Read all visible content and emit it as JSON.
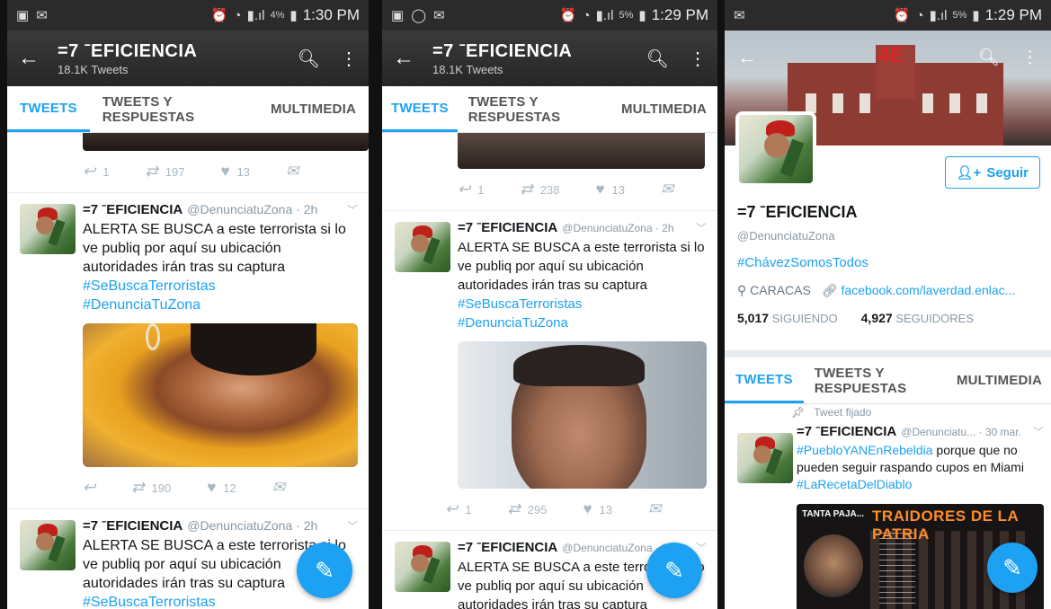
{
  "status_bars": [
    {
      "time": "1:30 PM",
      "battery": "4%",
      "icons": [
        "image-icon",
        "mail-icon"
      ]
    },
    {
      "time": "1:29 PM",
      "battery": "5%",
      "icons": [
        "image-icon",
        "whatsapp-icon",
        "mail-icon"
      ]
    },
    {
      "time": "1:29 PM",
      "battery": "5%",
      "icons": [
        "mail-icon"
      ]
    }
  ],
  "account": {
    "name": "=7 ˉEFICIENCIA",
    "tweet_count": "18.1K Tweets",
    "handle": "@DenunciatuZona",
    "handle_short": "@Denunciatu...",
    "bio_hashtag": "#ChávezSomosTodos",
    "location": "CARACAS",
    "website": "facebook.com/laverdad.enlac...",
    "following_count": "5,017",
    "following_label": "SIGUIENDO",
    "followers_count": "4,927",
    "followers_label": "SEGUIDORES",
    "follow_label": "Seguir"
  },
  "tabs": [
    "TWEETS",
    "TWEETS Y RESPUESTAS",
    "MULTIMEDIA"
  ],
  "feed_tweet": {
    "time": "2h",
    "text": "ALERTA SE BUSCA a este terrorista si lo ve publiq por aquí su ubicación autoridades irán tras su captura",
    "hashtags": [
      "#SeBuscaTerroristas",
      "#DenunciaTuZona"
    ]
  },
  "panel1": {
    "top_actions": {
      "reply": "1",
      "retweets": "197",
      "likes": "13"
    },
    "tweet_actions": {
      "retweets": "190",
      "likes": "12"
    }
  },
  "panel2": {
    "top_actions": {
      "reply": "1",
      "retweets": "238",
      "likes": "13"
    },
    "tweet_actions": {
      "reply": "1",
      "retweets": "295",
      "likes": "13"
    }
  },
  "pinned_tweet": {
    "label": "Tweet fijado",
    "time": "30 mar.",
    "hashtag1": "#PuebloYANEnRebeldia",
    "text": "porque que no pueden seguir raspando cupos en Miami",
    "hashtag2": "#LaRecetaDelDiablo",
    "media_label1": "TANTA PAJA...",
    "media_label2": "TRAIDORES DE LA PATRIA"
  },
  "cover_text": "4E",
  "colors": {
    "accent": "#1da1f2",
    "appbar": "#2b2b2b"
  }
}
